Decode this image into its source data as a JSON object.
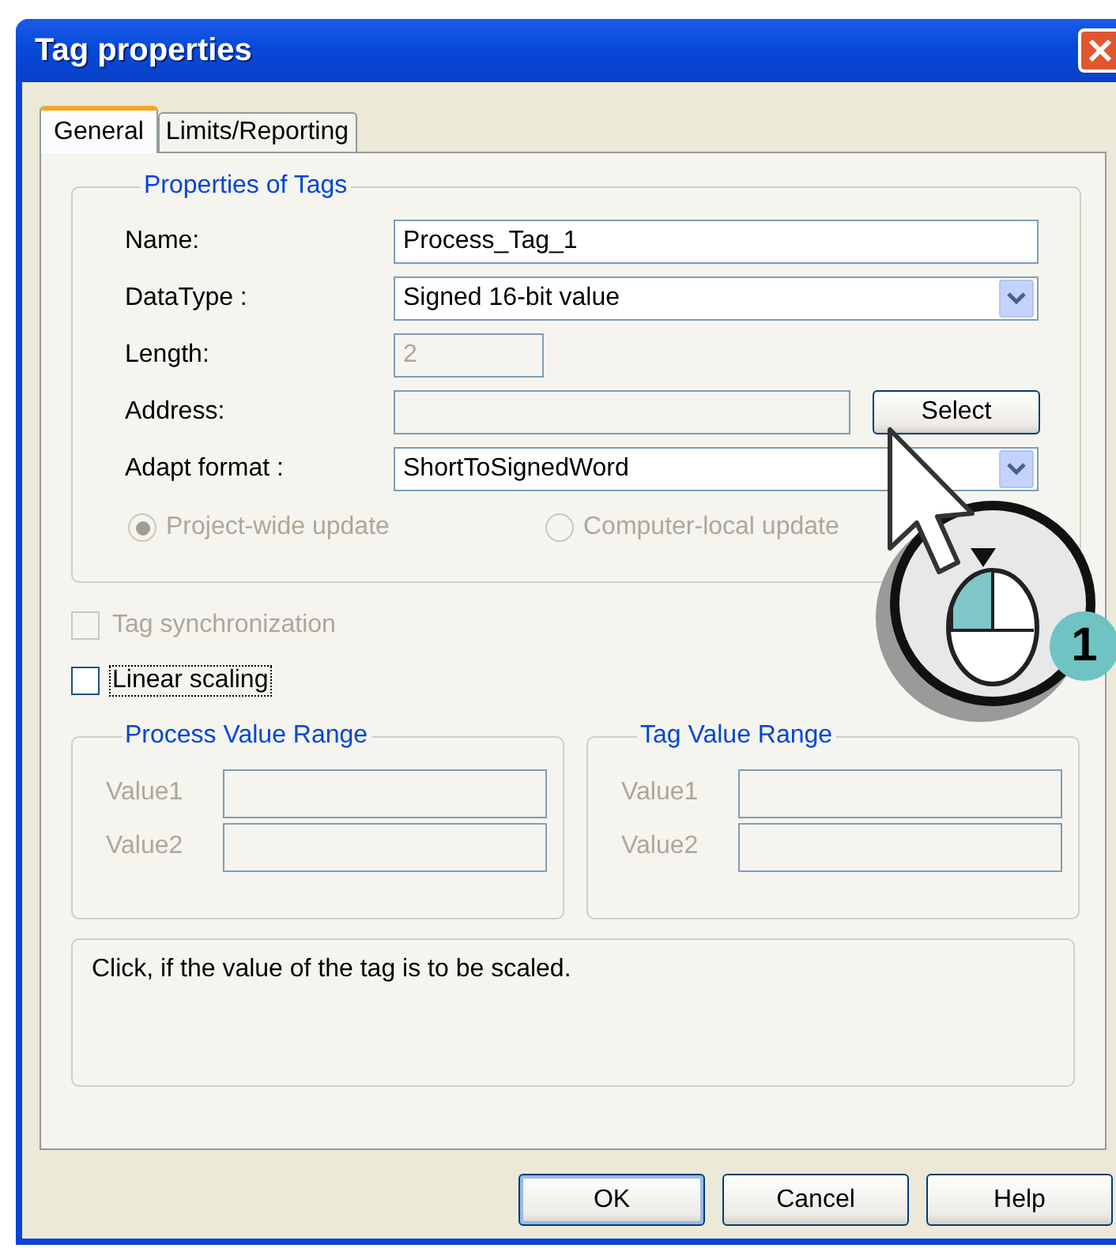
{
  "window": {
    "title": "Tag properties"
  },
  "tabs": [
    {
      "label": "General",
      "selected": true
    },
    {
      "label": "Limits/Reporting",
      "selected": false
    }
  ],
  "properties_group": {
    "title": "Properties of Tags",
    "fields": [
      {
        "kind": "text",
        "label": "Name:",
        "value": "Process_Tag_1"
      },
      {
        "kind": "dropdown",
        "label": "DataType :",
        "value": "Signed 16-bit value"
      },
      {
        "kind": "short",
        "label": "Length:",
        "value": "2",
        "disabled": true
      },
      {
        "kind": "browse",
        "label": "Address:",
        "button": "Select"
      },
      {
        "kind": "dropdown",
        "label": "Adapt format :",
        "value": "ShortToSignedWord"
      }
    ],
    "update_options": [
      {
        "label": "Project-wide update",
        "selected": true,
        "disabled": true
      },
      {
        "label": "Computer-local update",
        "selected": false,
        "disabled": true
      }
    ]
  },
  "checkboxes": [
    {
      "label": "Tag synchronization",
      "checked": false,
      "disabled": true,
      "focused": false
    },
    {
      "label": "Linear scaling",
      "checked": false,
      "disabled": false,
      "focused": true
    }
  ],
  "ranges": [
    {
      "title": "Process Value Range",
      "rows": [
        {
          "label": "Value1"
        },
        {
          "label": "Value2"
        }
      ]
    },
    {
      "title": "Tag Value Range",
      "rows": [
        {
          "label": "Value1"
        },
        {
          "label": "Value2"
        }
      ]
    }
  ],
  "description": "Click, if the value of the tag is to be scaled.",
  "buttons": [
    {
      "label": "OK",
      "default": true
    },
    {
      "label": "Cancel",
      "default": false
    },
    {
      "label": "Help",
      "default": false
    }
  ],
  "callout": {
    "step": "1"
  }
}
